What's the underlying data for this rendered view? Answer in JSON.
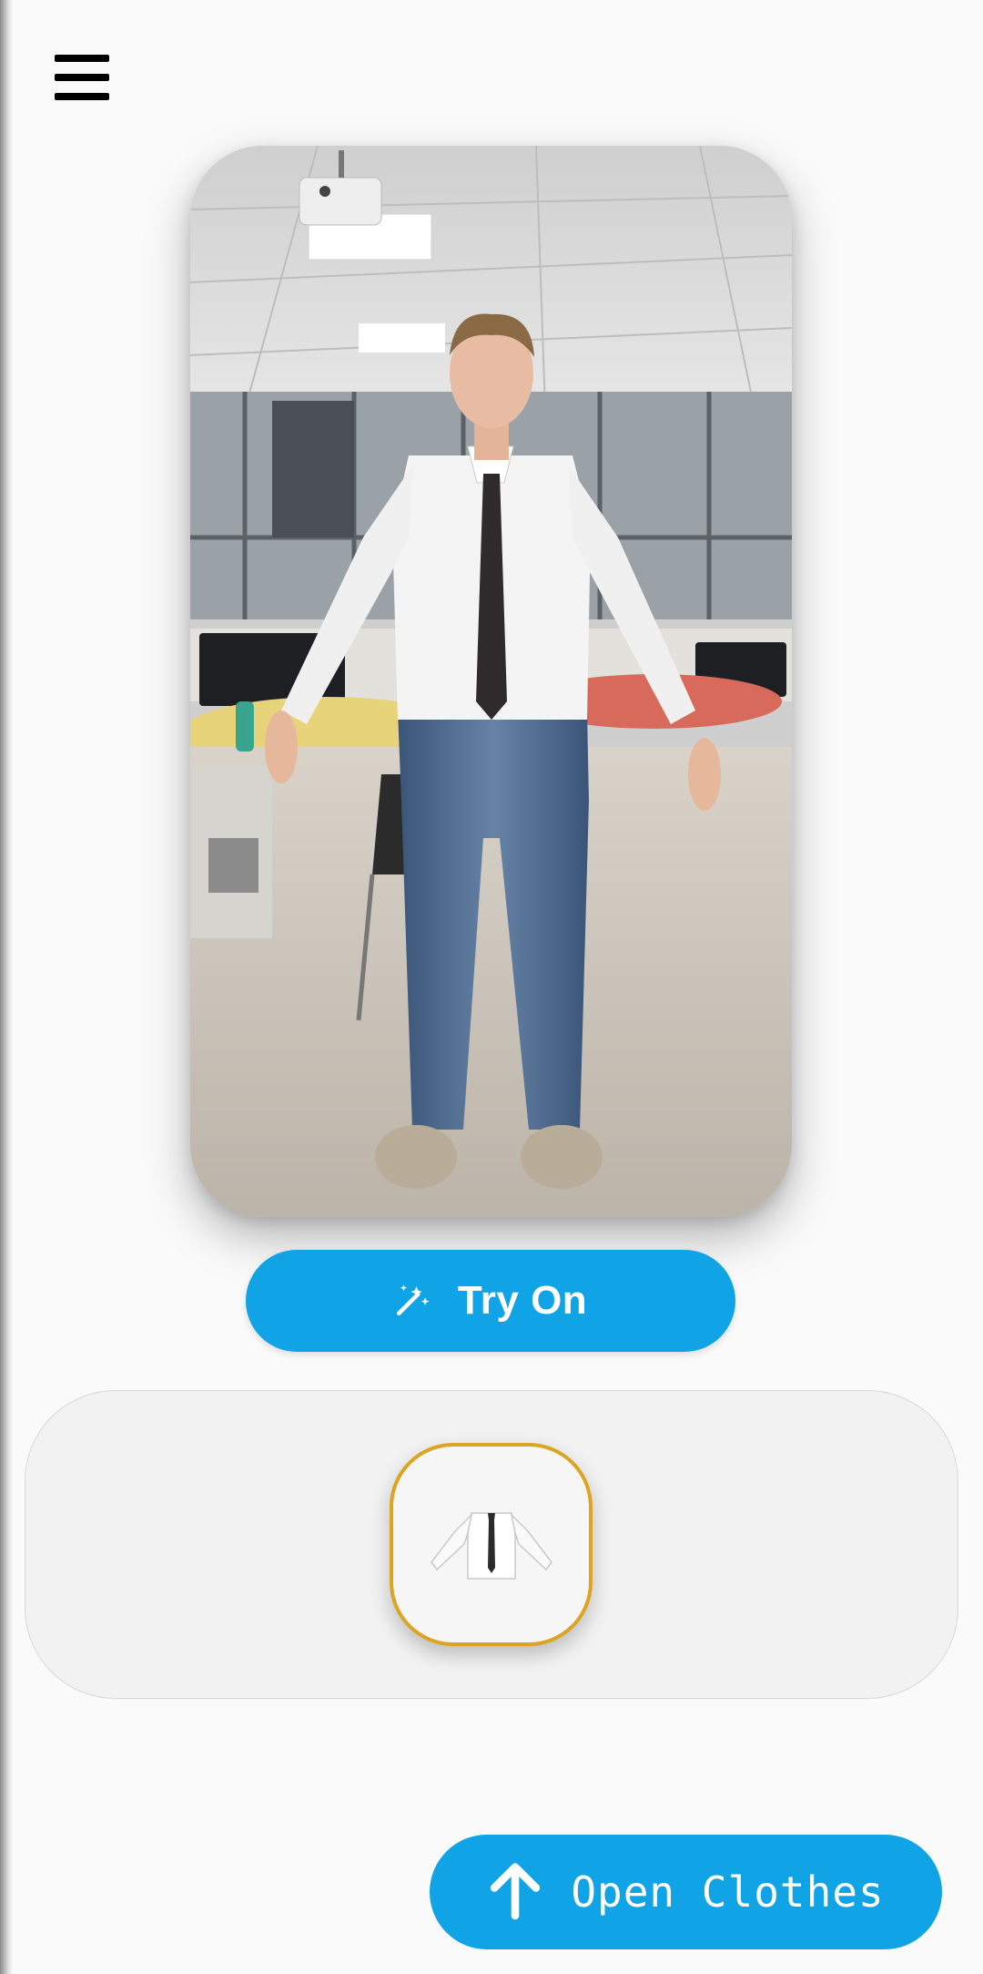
{
  "app": {
    "accent_color": "#10a4e6",
    "selected_border_color": "#dba521"
  },
  "menu": {
    "icon": "hamburger-menu-icon"
  },
  "preview": {
    "image": "person-photo"
  },
  "actions": {
    "try_on": {
      "label": "Try On",
      "icon": "magic-wand-icon"
    },
    "open_clothes": {
      "label": "Open Clothes",
      "icon": "arrow-up-icon"
    }
  },
  "garments": [
    {
      "icon": "white-shirt-with-tie",
      "selected": true
    }
  ]
}
